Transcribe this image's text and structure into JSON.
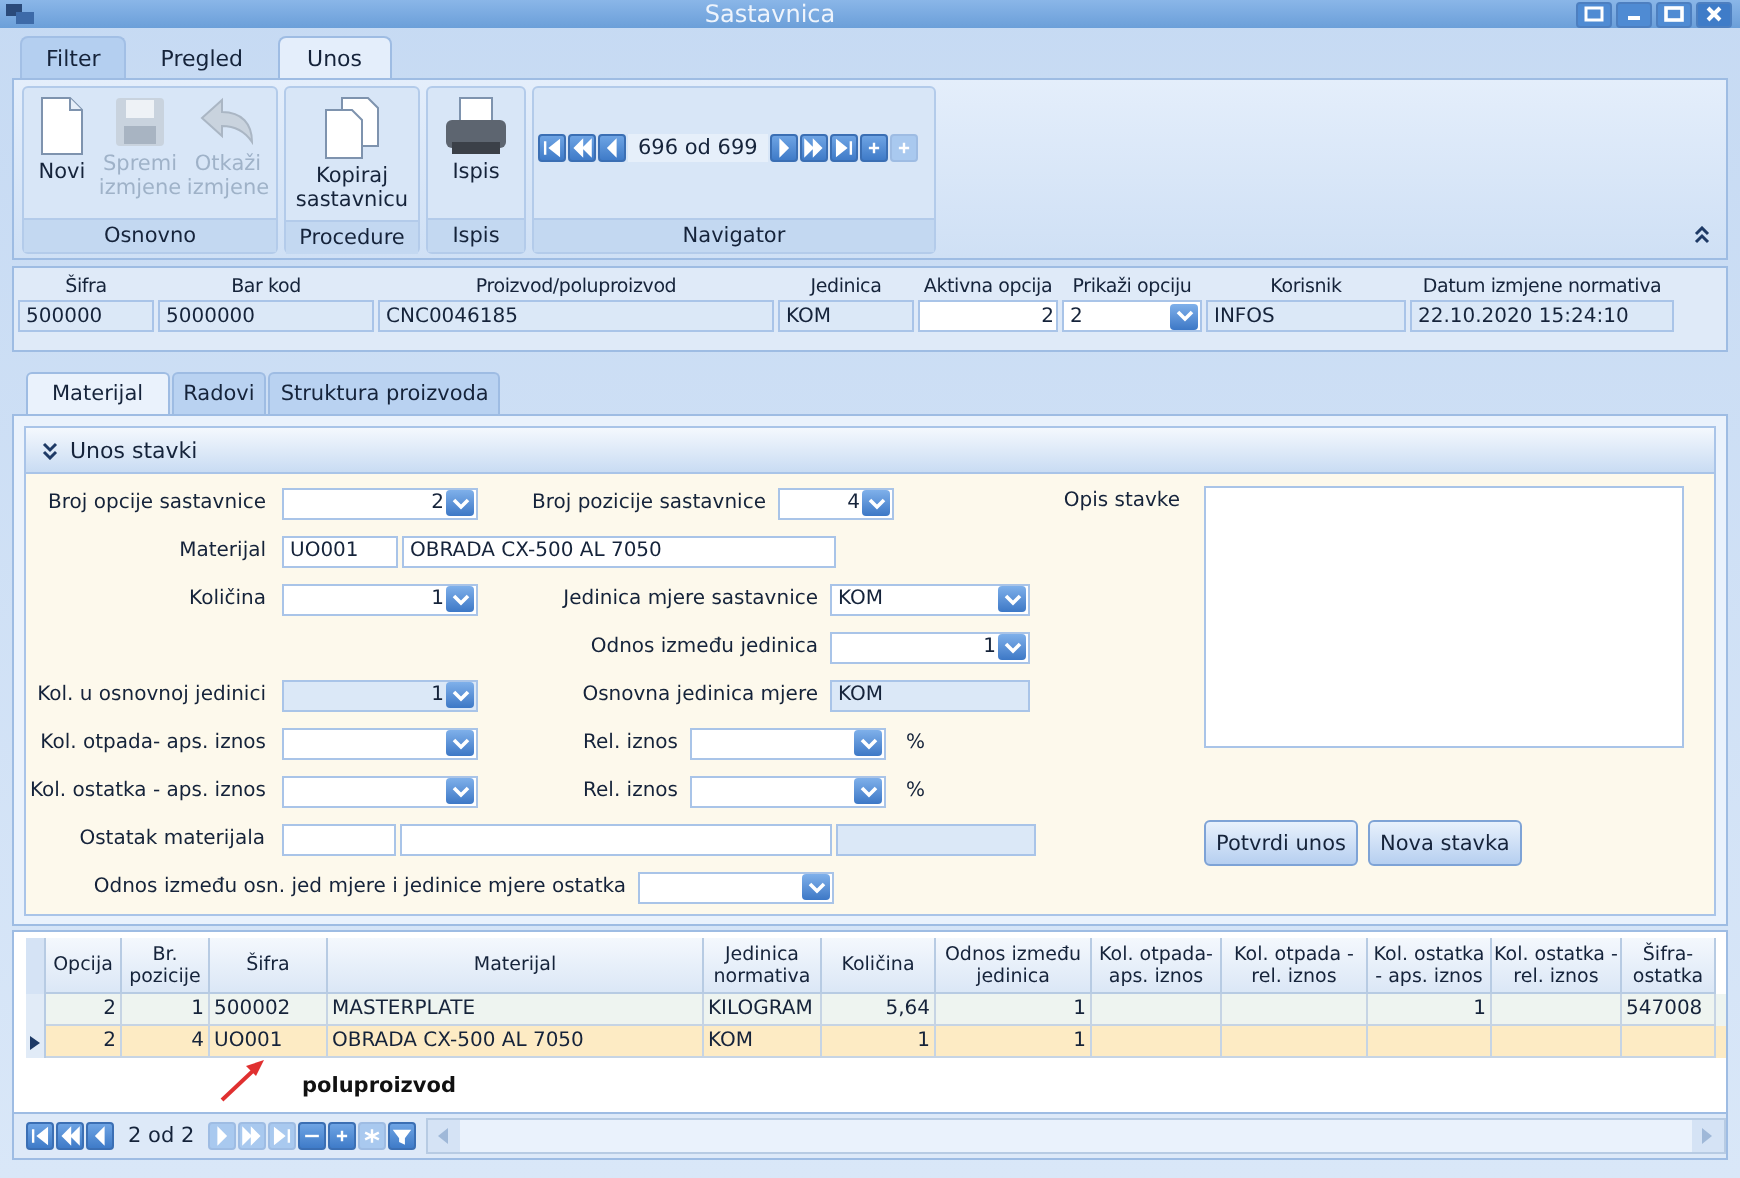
{
  "window": {
    "title": "Sastavnica"
  },
  "ribbon": {
    "tabs": [
      {
        "label": "Filter",
        "selected": false
      },
      {
        "label": "Pregled",
        "selected": false
      },
      {
        "label": "Unos",
        "selected": true
      }
    ],
    "groups": [
      {
        "label": "Osnovno",
        "buttons": [
          {
            "kind": "new",
            "label": "Novi",
            "disabled": false
          },
          {
            "kind": "save",
            "label": "Spremi izmjene",
            "disabled": true
          },
          {
            "kind": "undo",
            "label": "Otkaži izmjene",
            "disabled": true
          }
        ]
      },
      {
        "label": "Procedure",
        "buttons": [
          {
            "kind": "copy",
            "label": "Kopiraj sastavnicu",
            "disabled": false
          }
        ]
      },
      {
        "label": "Ispis",
        "buttons": [
          {
            "kind": "print",
            "label": "Ispis",
            "disabled": false
          }
        ]
      }
    ],
    "navigator": {
      "label": "Navigator",
      "record": "696 od 699",
      "buttons": [
        {
          "kind": "first",
          "disabled": false
        },
        {
          "kind": "prev-page",
          "disabled": false
        },
        {
          "kind": "prev",
          "disabled": false
        },
        {
          "kind": "next",
          "disabled": false
        },
        {
          "kind": "next-page",
          "disabled": false
        },
        {
          "kind": "last",
          "disabled": false
        },
        {
          "kind": "add",
          "disabled": false
        },
        {
          "kind": "add",
          "disabled": true
        }
      ]
    }
  },
  "header": {
    "fields": [
      {
        "label": "Šifra",
        "value": "500000",
        "readonly": true,
        "kind": "text"
      },
      {
        "label": "Bar kod",
        "value": "5000000",
        "readonly": true,
        "kind": "text"
      },
      {
        "label": "Proizvod/poluproizvod",
        "value": "CNC0046185",
        "readonly": true,
        "kind": "text"
      },
      {
        "label": "Jedinica",
        "value": "KOM",
        "readonly": true,
        "kind": "text"
      },
      {
        "label": "Aktivna opcija",
        "value": "2",
        "readonly": false,
        "kind": "number"
      },
      {
        "label": "Prikaži opciju",
        "value": "2",
        "readonly": false,
        "kind": "combo"
      },
      {
        "label": "Korisnik",
        "value": "INFOS",
        "readonly": true,
        "kind": "text"
      },
      {
        "label": "Datum izmjene normativa",
        "value": "22.10.2020 15:24:10",
        "readonly": true,
        "kind": "text"
      }
    ]
  },
  "detail_tabs": [
    {
      "label": "Materijal",
      "selected": true
    },
    {
      "label": "Radovi",
      "selected": false
    },
    {
      "label": "Struktura proizvoda",
      "selected": false
    }
  ],
  "section": {
    "title": "Unos stavki",
    "expanded": true
  },
  "form": {
    "option_no": {
      "label": "Broj opcije sastavnice",
      "value": "2"
    },
    "position_no": {
      "label": "Broj pozicije sastavnice",
      "value": "4"
    },
    "material": {
      "label": "Materijal",
      "code": "UO001",
      "name": "OBRADA CX-500 AL 7050"
    },
    "quantity": {
      "label": "Količina",
      "value": "1"
    },
    "unit": {
      "label": "Jedinica mjere sastavnice",
      "value": "KOM"
    },
    "unit_ratio": {
      "label": "Odnos između jedinica",
      "value": "1"
    },
    "base_qty": {
      "label": "Kol. u osnovnoj jedinici",
      "value": "1",
      "readonly": true
    },
    "base_unit": {
      "label": "Osnovna jedinica mjere",
      "value": "KOM",
      "readonly": true
    },
    "waste_abs": {
      "label": "Kol. otpada- aps. iznos"
    },
    "waste_rel": {
      "label": "Rel. iznos",
      "unit": "%"
    },
    "rest_abs": {
      "label": "Kol. ostatka - aps. iznos"
    },
    "rest_rel": {
      "label": "Rel. iznos",
      "unit": "%"
    },
    "rest_material": {
      "label": "Ostatak materijala"
    },
    "rest_ratio": {
      "label": "Odnos između osn. jed mjere i jedinice mjere ostatka"
    },
    "description": {
      "label": "Opis stavke"
    },
    "buttons": [
      {
        "label": "Potvrdi unos"
      },
      {
        "label": "Nova stavka"
      }
    ]
  },
  "table": {
    "columns": [
      {
        "label": "Opcija",
        "kind": "number"
      },
      {
        "label": "Br. pozicije",
        "kind": "number"
      },
      {
        "label": "Šifra",
        "kind": "text"
      },
      {
        "label": "Materijal",
        "kind": "text"
      },
      {
        "label": "Jedinica normativa",
        "kind": "text"
      },
      {
        "label": "Količina",
        "kind": "number"
      },
      {
        "label": "Odnos između jedinica",
        "kind": "number"
      },
      {
        "label": "Kol. otpada-aps. iznos",
        "kind": "number"
      },
      {
        "label": "Kol. otpada - rel. iznos",
        "kind": "number"
      },
      {
        "label": "Kol. ostatka - aps. iznos",
        "kind": "number"
      },
      {
        "label": "Kol. ostatka - rel. iznos",
        "kind": "number"
      },
      {
        "label": "Šifra-ostatka",
        "kind": "text"
      }
    ],
    "rows": [
      {
        "selected": false,
        "cells": [
          "2",
          "1",
          "500002",
          "MASTERPLATE",
          "KILOGRAM",
          "5,64",
          "1",
          "",
          "",
          "1",
          "",
          "547008"
        ]
      },
      {
        "selected": true,
        "cells": [
          "2",
          "4",
          "UO001",
          "OBRADA CX-500 AL 7050",
          "KOM",
          "1",
          "1",
          "",
          "",
          "",
          "",
          ""
        ]
      }
    ]
  },
  "annotation": {
    "text": "poluproizvod"
  },
  "grid_navigator": {
    "record": "2 od 2",
    "buttons": [
      {
        "kind": "first",
        "disabled": false
      },
      {
        "kind": "prev-page",
        "disabled": false
      },
      {
        "kind": "prev",
        "disabled": false
      },
      {
        "kind": "next",
        "disabled": true
      },
      {
        "kind": "next-page",
        "disabled": true
      },
      {
        "kind": "last",
        "disabled": true
      },
      {
        "kind": "remove",
        "disabled": false
      },
      {
        "kind": "add",
        "disabled": false
      },
      {
        "kind": "star",
        "disabled": true
      },
      {
        "kind": "filter",
        "disabled": false
      }
    ]
  }
}
